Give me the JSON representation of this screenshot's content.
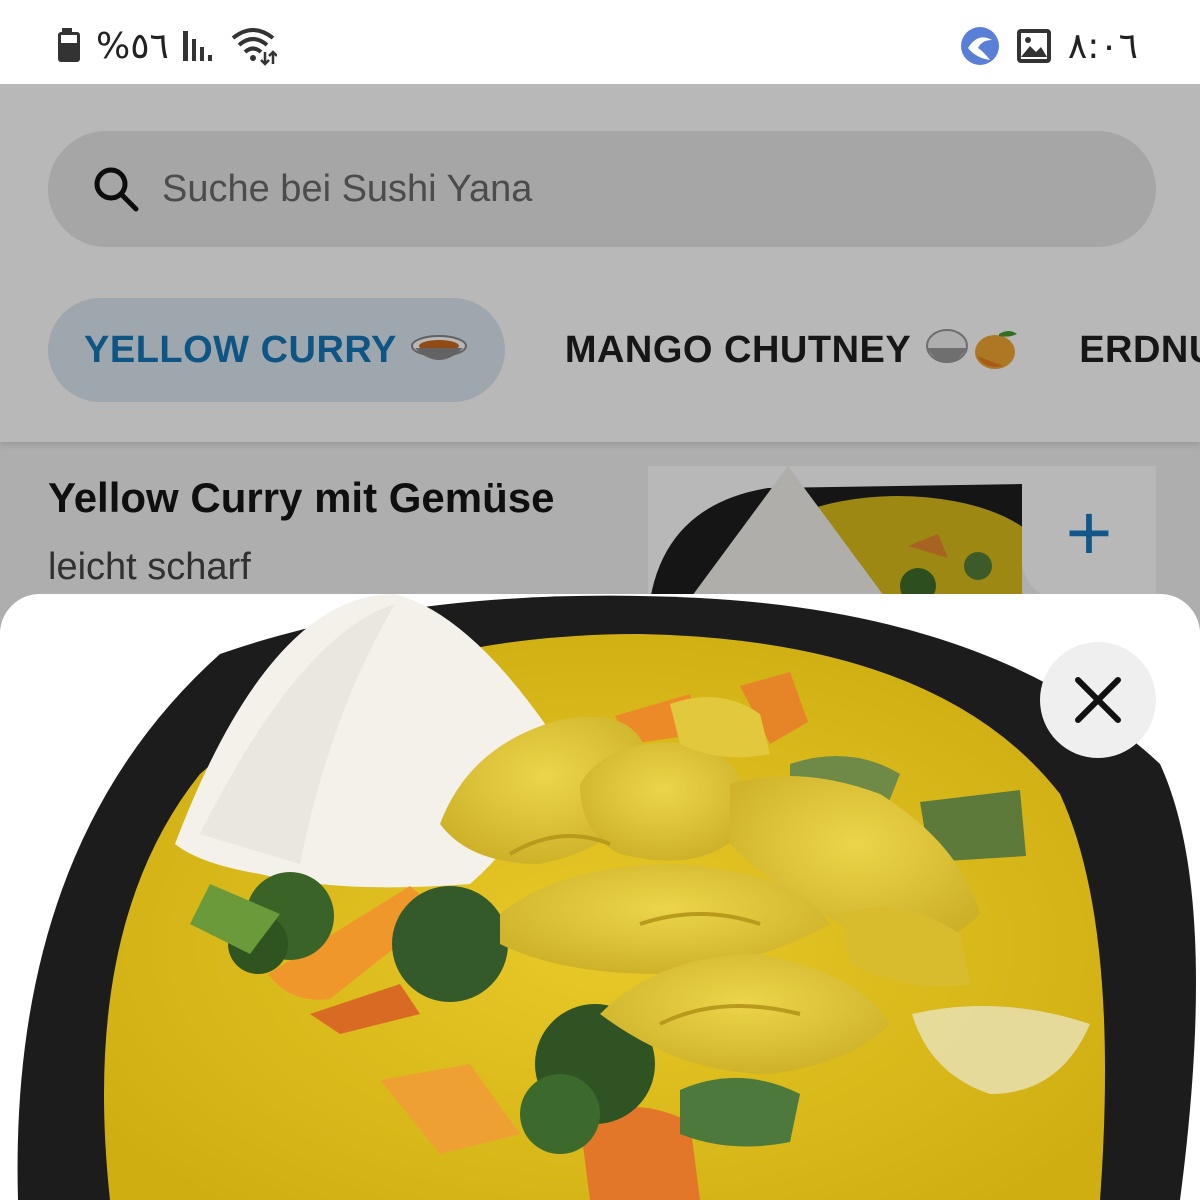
{
  "status_bar": {
    "battery_text": "%٥٦",
    "time": "٨:٠٦"
  },
  "search": {
    "placeholder": "Suche bei Sushi Yana"
  },
  "tabs": [
    {
      "label": "YELLOW CURRY",
      "emoji": "🍛",
      "active": true
    },
    {
      "label": "MANGO CHUTNEY",
      "emoji": "🍚🥭",
      "active": false
    },
    {
      "label": "ERDNU",
      "active": false
    }
  ],
  "dish": {
    "title": "Yellow Curry mit Gemüse",
    "description": "leicht scharf",
    "add_label": "+"
  },
  "colors": {
    "accent": "#1577b8",
    "tab_active_bg": "#dce8f2",
    "curry": "#e3c21c"
  },
  "icons": {
    "search": "search-icon",
    "close": "close-icon",
    "add": "plus-icon",
    "battery": "battery-icon",
    "signal": "signal-icon",
    "wifi": "wifi-icon",
    "image": "image-icon",
    "app": "app-icon"
  }
}
